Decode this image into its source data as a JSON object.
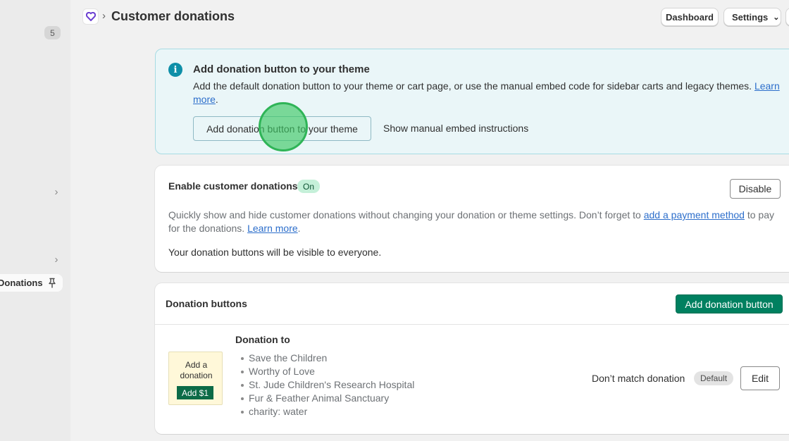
{
  "sidebar": {
    "badge_count": "5",
    "active_item": {
      "label": "Donations",
      "pin_icon": "pin-icon"
    }
  },
  "header": {
    "app_icon": "heart-icon",
    "breadcrumb_separator": "›",
    "title": "Customer donations",
    "dashboard_label": "Dashboard",
    "settings_label": "Settings",
    "settings_chevron": "⌄"
  },
  "banner": {
    "icon": "info-icon",
    "icon_glyph": "i",
    "title": "Add donation button to your theme",
    "text": "Add the default donation button to your theme or cart page, or use the manual embed code for sidebar carts and legacy themes. ",
    "learn_more": "Learn more",
    "period": ".",
    "primary_label": "Add donation button to your theme",
    "secondary_label": "Show manual embed instructions"
  },
  "enable_card": {
    "title": "Enable customer donations",
    "status_badge": "On",
    "disable_label": "Disable",
    "desc_part1": "Quickly show and hide customer donations without changing your donation or theme settings. Don’t forget to ",
    "payment_link": "add a payment method",
    "desc_part2": " to pay for the donations. ",
    "learn_more": "Learn more",
    "period": ".",
    "visibility_text": "Your donation buttons will be visible to everyone."
  },
  "buttons_card": {
    "title": "Donation buttons",
    "add_label": "Add donation button",
    "preview": {
      "text": "Add a donation",
      "button_label": "Add $1"
    },
    "donation_to_label": "Donation to",
    "charities": [
      "Save the Children",
      "Worthy of Love",
      "St. Jude Children's Research Hospital",
      "Fur & Feather Animal Sanctuary",
      "charity: water"
    ],
    "match_text": "Don’t match donation",
    "default_badge": "Default",
    "edit_label": "Edit"
  },
  "colors": {
    "primary": "#008060",
    "banner_bg": "#eaf6f8",
    "info_icon": "#0e8fa8",
    "on_badge_bg": "#c5f0d9",
    "link": "#2c6ecb"
  }
}
